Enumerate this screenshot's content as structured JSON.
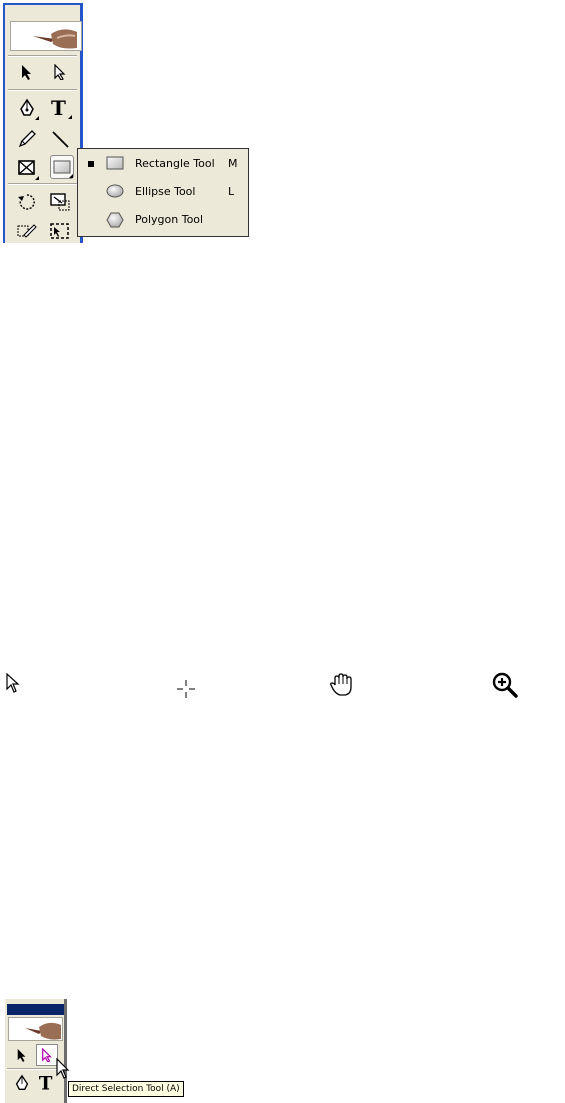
{
  "flyout": {
    "items": [
      {
        "label": "Rectangle Tool",
        "shortcut": "M",
        "selected": true,
        "icon": "rectangle-icon"
      },
      {
        "label": "Ellipse Tool",
        "shortcut": "L",
        "selected": false,
        "icon": "ellipse-icon"
      },
      {
        "label": "Polygon Tool",
        "shortcut": "",
        "selected": false,
        "icon": "polygon-icon"
      }
    ]
  },
  "toolbox": {
    "tools": [
      "selection-tool",
      "direct-selection-tool",
      "pen-tool",
      "type-tool",
      "pencil-tool",
      "line-tool",
      "frame-tool",
      "rectangle-tool",
      "rotate-tool",
      "scale-tool",
      "free-transform-tool",
      "crop-tool"
    ]
  },
  "cursors": [
    "arrow-pointer-icon",
    "crosshair-icon",
    "hand-icon",
    "zoom-in-icon"
  ],
  "tooltip": {
    "text": "Direct Selection Tool (A)"
  }
}
